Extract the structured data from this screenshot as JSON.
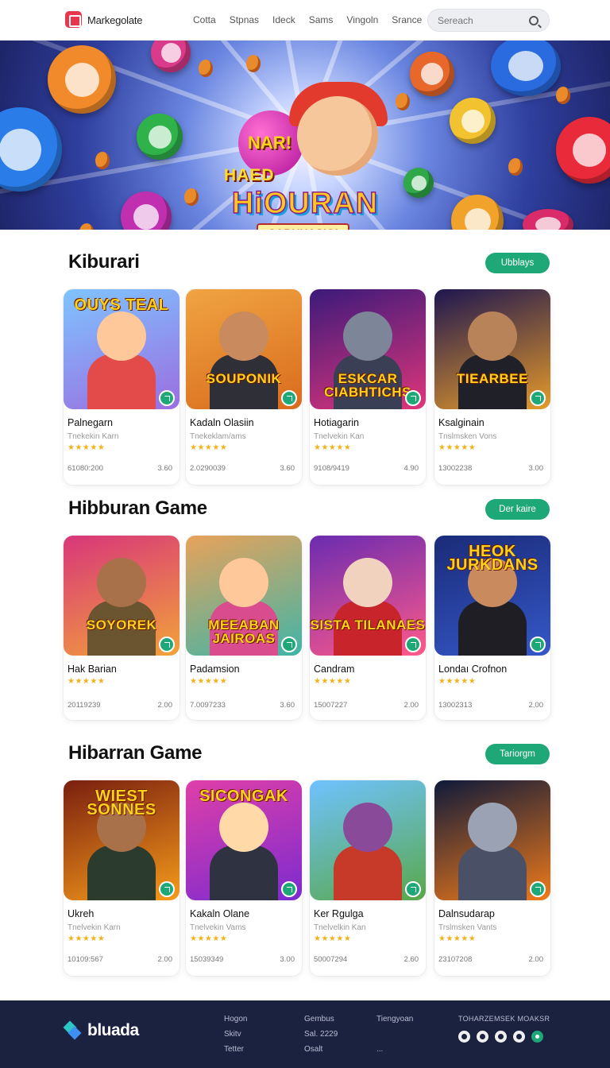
{
  "header": {
    "brand": "Markegolate",
    "nav": [
      "Cotta",
      "Stpnas",
      "Ideck",
      "Sams",
      "Vingoln",
      "Srance"
    ],
    "search_placeholder": "Sereach"
  },
  "hero": {
    "line1": "NAR!",
    "line2": "HAED",
    "line3": "HiOURAN",
    "line4": "CABUHASIGI"
  },
  "sections": [
    {
      "title": "Kiburari",
      "action": "Ubblays",
      "cards": [
        {
          "title": "Palnegarn",
          "subtitle": "Tnekekin Karn",
          "stars": "★★★★★",
          "number": "61080:200",
          "price": "3.60",
          "thumb_text": "OUYS TEAL",
          "thumb_text_pos": "top",
          "bg": "#7ec4ff",
          "bg2": "#9b6de0",
          "char": "#ffc89a",
          "body": "#e34a4a"
        },
        {
          "title": "Kadaln Olasiin",
          "subtitle": "Tnekeklam/ams",
          "stars": "★★★★★",
          "number": "2.0290039",
          "price": "3.60",
          "thumb_text": "SOUPONIK",
          "thumb_text_pos": "bottom",
          "bg": "#f0a442",
          "bg2": "#d96b1c",
          "char": "#c98a5d",
          "body": "#2f2f37"
        },
        {
          "title": "Hotiagarin",
          "subtitle": "Tnelvekin Kan",
          "stars": "★★★★★",
          "number": "9108/9419",
          "price": "4.90",
          "thumb_text": "ESKCAR CIABHTICHS",
          "thumb_text_pos": "bottom",
          "bg": "#3b1a7a",
          "bg2": "#e0357a",
          "char": "#7d8599",
          "body": "#3a3f55"
        },
        {
          "title": "Ksalginain",
          "subtitle": "Tnslmsken Vons",
          "stars": "★★★★★",
          "number": "13002238",
          "price": "3.00",
          "thumb_text": "TIEARBEE",
          "thumb_text_pos": "bottom",
          "bg": "#1d1650",
          "bg2": "#e59a2a",
          "char": "#b9835a",
          "body": "#202028"
        }
      ]
    },
    {
      "title": "Hibburan Game",
      "action": "Der kaire",
      "cards": [
        {
          "title": "Hak Barian",
          "subtitle": "",
          "stars": "★★★★★",
          "number": "20119239",
          "price": "2.00",
          "thumb_text": "SOYOREK",
          "thumb_text_pos": "bottom",
          "bg": "#d8367a",
          "bg2": "#f2a23a",
          "char": "#a8714a",
          "body": "#6b5430"
        },
        {
          "title": "Padamsion",
          "subtitle": "",
          "stars": "★★★★★",
          "number": "7.0097233",
          "price": "3.60",
          "thumb_text": "MEEABAN JAIROAS",
          "thumb_text_pos": "bottom",
          "bg": "#e8a25a",
          "bg2": "#3fb5a8",
          "char": "#ffc89a",
          "body": "#d94c8e"
        },
        {
          "title": "Candram",
          "subtitle": "",
          "stars": "★★★★★",
          "number": "15007227",
          "price": "2.00",
          "thumb_text": "SISTA TILANAES",
          "thumb_text_pos": "bottom",
          "bg": "#6a2bb0",
          "bg2": "#ff5a8a",
          "char": "#f0d2bf",
          "body": "#c7252b"
        },
        {
          "title": "Londaı Crofnon",
          "subtitle": "",
          "stars": "★★★★★",
          "number": "13002313",
          "price": "2,00",
          "thumb_text": "HEOK JURKDANS",
          "thumb_text_pos": "top",
          "bg": "#1a2b78",
          "bg2": "#3558c9",
          "char": "#c98a5d",
          "body": "#1e1e24"
        }
      ]
    },
    {
      "title": "Hibarran Game",
      "action": "Tariorgm",
      "cards": [
        {
          "title": "Ukreh",
          "subtitle": "Tnelvekin Karn",
          "stars": "★★★★★",
          "number": "10109:567",
          "price": "2.00",
          "thumb_text": "WIEST SONNES",
          "thumb_text_pos": "top",
          "bg": "#7a1f0f",
          "bg2": "#f59b1b",
          "char": "#a8714a",
          "body": "#2b3b2e"
        },
        {
          "title": "Kakaln Olane",
          "subtitle": "Tnelvekin Vams",
          "stars": "★★★★★",
          "number": "15039349",
          "price": "3.00",
          "thumb_text": "SICONGAK",
          "thumb_text_pos": "top",
          "bg": "#e03fa8",
          "bg2": "#7b2bd0",
          "char": "#ffd9a8",
          "body": "#2f3240"
        },
        {
          "title": "Ker Rgulga",
          "subtitle": "Tnelvelkin Kan",
          "stars": "★★★★★",
          "number": "50007294",
          "price": "2.60",
          "thumb_text": "",
          "thumb_text_pos": "bottom",
          "bg": "#6fc2ff",
          "bg2": "#59a84a",
          "char": "#8a4a9a",
          "body": "#c73a2a"
        },
        {
          "title": "Dalnsudarap",
          "subtitle": "Trslmsken Vants",
          "stars": "★★★★★",
          "number": "23107208",
          "price": "2.00",
          "thumb_text": "",
          "thumb_text_pos": "bottom",
          "bg": "#0f1a3a",
          "bg2": "#f07a1a",
          "char": "#9aa2b3",
          "body": "#4a5066"
        }
      ]
    }
  ],
  "footer": {
    "brand": "bluada",
    "col1": [
      "Hogon",
      "Skitv",
      "Tetter"
    ],
    "col2": [
      "Gembus",
      "Sal. 2229",
      "Osalt"
    ],
    "col3": [
      "Tiengyoan",
      "",
      "..."
    ],
    "social_title": "TOHARZEMSEK MOAKSR",
    "social_icons": [
      "circle-icon",
      "clock-icon",
      "link-icon",
      "close-icon",
      "chat-icon"
    ]
  }
}
